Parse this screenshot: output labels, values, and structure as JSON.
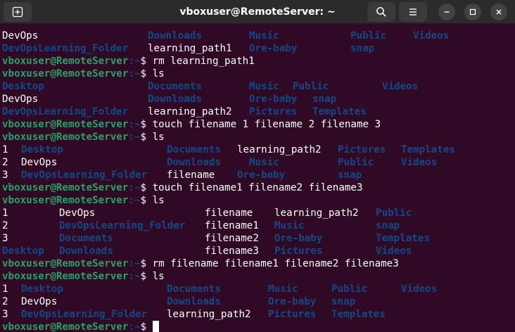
{
  "window": {
    "title": "vboxuser@RemoteServer: ~"
  },
  "colors": {
    "background": "#300a24",
    "prompt": "#26a269",
    "directory": "#12488b",
    "text": "#ffffff"
  },
  "icons": {
    "new_tab": "new-tab-icon",
    "search": "search-icon",
    "menu": "hamburger-menu-icon",
    "minimize": "minimize-icon",
    "maximize": "maximize-icon",
    "close": "close-icon"
  },
  "terminal": {
    "prompt_user": "vboxuser@RemoteServer",
    "prompt_path": ":~",
    "prompt_symbol": "$",
    "lines": [
      {
        "kind": "output",
        "cells": [
          {
            "text": "DevOps",
            "type": "f"
          },
          {
            "text": "Downloads",
            "type": "d"
          },
          {
            "text": "Music",
            "type": "d"
          },
          {
            "text": "Public",
            "type": "d"
          },
          {
            "text": "Videos",
            "type": "d"
          }
        ]
      },
      {
        "kind": "output",
        "cells": [
          {
            "text": "DevOpsLearning_Folder",
            "type": "d"
          },
          {
            "text": "learning_path1",
            "type": "f"
          },
          {
            "text": "Ore-baby",
            "type": "d"
          },
          {
            "text": "snap",
            "type": "d"
          }
        ]
      },
      {
        "kind": "prompt",
        "command": "rm learning_path1"
      },
      {
        "kind": "prompt",
        "command": "ls"
      },
      {
        "kind": "output",
        "cells": [
          {
            "text": "Desktop",
            "type": "d"
          },
          {
            "text": "Documents",
            "type": "d"
          },
          {
            "text": "Music",
            "type": "d"
          },
          {
            "text": "Public",
            "type": "d"
          },
          {
            "text": "Videos",
            "type": "d"
          }
        ]
      },
      {
        "kind": "output",
        "cells": [
          {
            "text": "DevOps",
            "type": "f"
          },
          {
            "text": "Downloads",
            "type": "d"
          },
          {
            "text": "Ore-baby",
            "type": "d"
          },
          {
            "text": "snap",
            "type": "d"
          }
        ]
      },
      {
        "kind": "output",
        "cells": [
          {
            "text": "DevOpsLearning_Folder",
            "type": "d"
          },
          {
            "text": "learning_path2",
            "type": "f"
          },
          {
            "text": "Pictures",
            "type": "d"
          },
          {
            "text": "Templates",
            "type": "d"
          }
        ]
      },
      {
        "kind": "prompt",
        "command": "touch filename 1 filename 2 filename 3"
      },
      {
        "kind": "prompt",
        "command": "ls"
      },
      {
        "kind": "output",
        "cells": [
          {
            "text": "1",
            "type": "f"
          },
          {
            "text": "Desktop",
            "type": "d"
          },
          {
            "text": "Documents",
            "type": "d"
          },
          {
            "text": "learning_path2",
            "type": "f"
          },
          {
            "text": "Pictures",
            "type": "d"
          },
          {
            "text": "Templates",
            "type": "d"
          }
        ]
      },
      {
        "kind": "output",
        "cells": [
          {
            "text": "2",
            "type": "f"
          },
          {
            "text": "DevOps",
            "type": "f"
          },
          {
            "text": "Downloads",
            "type": "d"
          },
          {
            "text": "Music",
            "type": "d"
          },
          {
            "text": "Public",
            "type": "d"
          },
          {
            "text": "Videos",
            "type": "d"
          }
        ]
      },
      {
        "kind": "output",
        "cells": [
          {
            "text": "3",
            "type": "f"
          },
          {
            "text": "DevOpsLearning_Folder",
            "type": "d"
          },
          {
            "text": "filename",
            "type": "f"
          },
          {
            "text": "Ore-baby",
            "type": "d"
          },
          {
            "text": "snap",
            "type": "d"
          }
        ]
      },
      {
        "kind": "prompt",
        "command": "touch filename1 filename2 filename3"
      },
      {
        "kind": "prompt",
        "command": "ls"
      },
      {
        "kind": "output",
        "cells": [
          {
            "text": "1",
            "type": "f"
          },
          {
            "text": "DevOps",
            "type": "f"
          },
          {
            "text": "filename",
            "type": "f"
          },
          {
            "text": "learning_path2",
            "type": "f"
          },
          {
            "text": "Public",
            "type": "d"
          }
        ]
      },
      {
        "kind": "output",
        "cells": [
          {
            "text": "2",
            "type": "f"
          },
          {
            "text": "DevOpsLearning_Folder",
            "type": "d"
          },
          {
            "text": "filename1",
            "type": "f"
          },
          {
            "text": "Music",
            "type": "d"
          },
          {
            "text": "snap",
            "type": "d"
          }
        ]
      },
      {
        "kind": "output",
        "cells": [
          {
            "text": "3",
            "type": "f"
          },
          {
            "text": "Documents",
            "type": "d"
          },
          {
            "text": "filename2",
            "type": "f"
          },
          {
            "text": "Ore-baby",
            "type": "d"
          },
          {
            "text": "Templates",
            "type": "d"
          }
        ]
      },
      {
        "kind": "output",
        "cells": [
          {
            "text": "Desktop",
            "type": "d"
          },
          {
            "text": "Downloads",
            "type": "d"
          },
          {
            "text": "filename3",
            "type": "f"
          },
          {
            "text": "Pictures",
            "type": "d"
          },
          {
            "text": "Videos",
            "type": "d"
          }
        ]
      },
      {
        "kind": "prompt",
        "command": "rm filename filename1 filename2 filename3"
      },
      {
        "kind": "prompt",
        "command": "ls"
      },
      {
        "kind": "output",
        "cells": [
          {
            "text": "1",
            "type": "f"
          },
          {
            "text": "Desktop",
            "type": "d"
          },
          {
            "text": "Documents",
            "type": "d"
          },
          {
            "text": "Music",
            "type": "d"
          },
          {
            "text": "Public",
            "type": "d"
          },
          {
            "text": "Videos",
            "type": "d"
          }
        ]
      },
      {
        "kind": "output",
        "cells": [
          {
            "text": "2",
            "type": "f"
          },
          {
            "text": "DevOps",
            "type": "f"
          },
          {
            "text": "Downloads",
            "type": "d"
          },
          {
            "text": "Ore-baby",
            "type": "d"
          },
          {
            "text": "snap",
            "type": "d"
          }
        ]
      },
      {
        "kind": "output",
        "cells": [
          {
            "text": "3",
            "type": "f"
          },
          {
            "text": "DevOpsLearning_Folder",
            "type": "d"
          },
          {
            "text": "learning_path2",
            "type": "f"
          },
          {
            "text": "Pictures",
            "type": "d"
          },
          {
            "text": "Templates",
            "type": "d"
          }
        ]
      },
      {
        "kind": "prompt",
        "command": "",
        "cursor": true
      }
    ]
  }
}
